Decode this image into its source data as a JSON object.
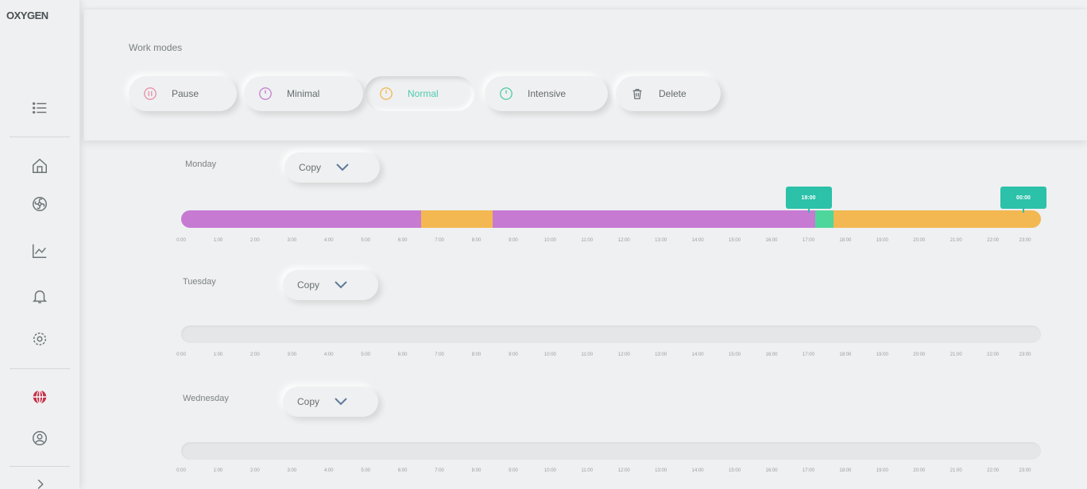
{
  "app": {
    "logo": "OXYGEN"
  },
  "sidebar": {
    "icons": [
      "menu-icon",
      "home-icon",
      "fan-icon",
      "chart-icon",
      "bell-icon",
      "settings-icon",
      "globe-icon",
      "user-icon"
    ]
  },
  "work_modes": {
    "title": "Work modes",
    "buttons": [
      {
        "label": "Pause",
        "icon": "pause-icon",
        "color": "#e98aa5"
      },
      {
        "label": "Minimal",
        "icon": "clock-icon",
        "color": "#c57ad0"
      },
      {
        "label": "Normal",
        "icon": "clock-icon",
        "color": "#f2b64c",
        "active": true
      },
      {
        "label": "Intensive",
        "icon": "clock-icon",
        "color": "#4ecb9e"
      },
      {
        "label": "Delete",
        "icon": "trash-icon",
        "color": "#6b7074"
      }
    ]
  },
  "days": [
    {
      "name": "Monday",
      "copy_label": "Copy",
      "segments": [
        {
          "start": 0,
          "end": 6.7,
          "mode": "Minimal",
          "color": "#c77ad2"
        },
        {
          "start": 6.7,
          "end": 8.7,
          "mode": "Normal",
          "color": "#f3b851"
        },
        {
          "start": 8.7,
          "end": 17.7,
          "mode": "Minimal",
          "color": "#c77ad2"
        },
        {
          "start": 17.7,
          "end": 18.2,
          "mode": "Intensive",
          "color": "#4fd69d"
        },
        {
          "start": 18.2,
          "end": 24,
          "mode": "Normal",
          "color": "#f3b851"
        }
      ],
      "tags": [
        {
          "label": "18:00",
          "hour": 18
        },
        {
          "label": "00:00",
          "hour": 24
        }
      ]
    },
    {
      "name": "Tuesday",
      "copy_label": "Copy",
      "segments": [],
      "tags": []
    },
    {
      "name": "Wednesday",
      "copy_label": "Copy",
      "segments": [],
      "tags": []
    }
  ],
  "hours": [
    "0:00",
    "1:00",
    "2:00",
    "3:00",
    "4:00",
    "5:00",
    "6:00",
    "7:00",
    "8:00",
    "9:00",
    "10:00",
    "11:00",
    "12:00",
    "13:00",
    "14:00",
    "15:00",
    "16:00",
    "17:00",
    "18:00",
    "19:00",
    "20:00",
    "21:00",
    "22:00",
    "23:00"
  ]
}
